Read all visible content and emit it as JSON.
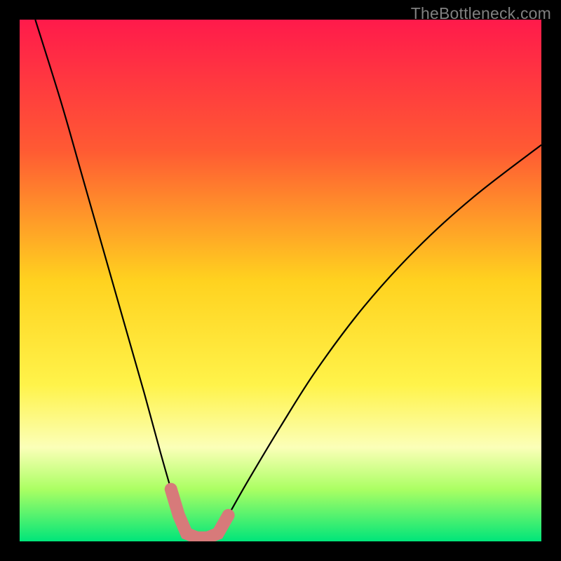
{
  "watermark": "TheBottleneck.com",
  "chart_data": {
    "type": "line",
    "title": "",
    "xlabel": "",
    "ylabel": "",
    "xlim": [
      0,
      100
    ],
    "ylim": [
      0,
      100
    ],
    "grid": false,
    "background_gradient": {
      "direction": "vertical",
      "stops": [
        {
          "offset": 0.0,
          "color": "#ff1a4b"
        },
        {
          "offset": 0.25,
          "color": "#ff5a33"
        },
        {
          "offset": 0.5,
          "color": "#ffd21f"
        },
        {
          "offset": 0.7,
          "color": "#fff34a"
        },
        {
          "offset": 0.82,
          "color": "#fbffb8"
        },
        {
          "offset": 0.9,
          "color": "#abff63"
        },
        {
          "offset": 1.0,
          "color": "#00e57a"
        }
      ]
    },
    "series": [
      {
        "name": "bottleneck-curve",
        "color": "#000000",
        "width": 2.2,
        "x": [
          3,
          8,
          12,
          16,
          20,
          24,
          27,
          29,
          30.5,
          32,
          34,
          36,
          38,
          40,
          44,
          50,
          57,
          66,
          76,
          87,
          100
        ],
        "y": [
          100,
          84,
          70,
          56,
          42,
          28,
          17,
          10,
          5,
          1.5,
          0.7,
          0.7,
          1.5,
          5,
          12,
          22,
          33,
          45,
          56,
          66,
          76
        ]
      },
      {
        "name": "highlight-band",
        "type": "highlight",
        "color": "#d77a7a",
        "x_range": [
          29,
          40
        ],
        "y_level": 0.9,
        "thickness": 18
      }
    ],
    "annotations": []
  }
}
